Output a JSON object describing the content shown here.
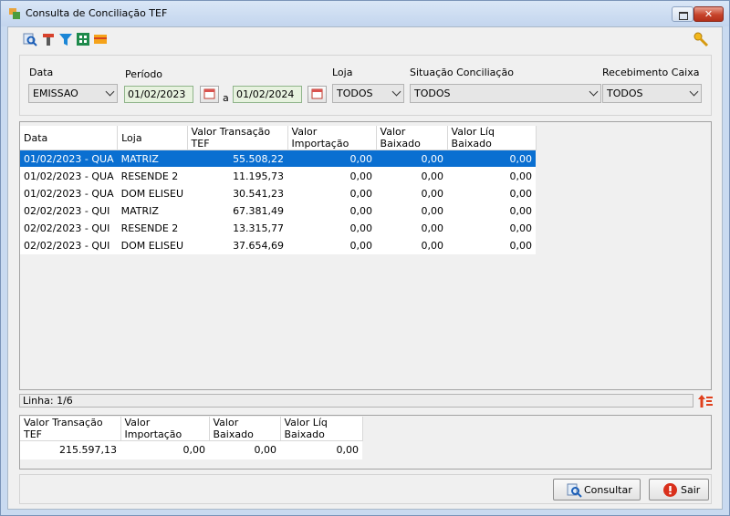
{
  "window": {
    "title": "Consulta de Conciliação TEF"
  },
  "filters": {
    "data_label": "Data",
    "data_value": "EMISSAO",
    "periodo_label": "Período",
    "date_from": "01/02/2023",
    "date_sep": "a",
    "date_to": "01/02/2024",
    "loja_label": "Loja",
    "loja_value": "TODOS",
    "situacao_label": "Situação Conciliação",
    "situacao_value": "TODOS",
    "receb_label": "Recebimento Caixa",
    "receb_value": "TODOS"
  },
  "grid": {
    "columns": [
      "Data",
      "Loja",
      "Valor Transação TEF",
      "Valor Importação",
      "Valor Baixado",
      "Valor Líq Baixado"
    ],
    "rows": [
      [
        "01/02/2023 - QUA",
        "MATRIZ",
        "55.508,22",
        "0,00",
        "0,00",
        "0,00"
      ],
      [
        "01/02/2023 - QUA",
        "RESENDE 2",
        "11.195,73",
        "0,00",
        "0,00",
        "0,00"
      ],
      [
        "01/02/2023 - QUA",
        "DOM ELISEU",
        "30.541,23",
        "0,00",
        "0,00",
        "0,00"
      ],
      [
        "02/02/2023 - QUI",
        "MATRIZ",
        "67.381,49",
        "0,00",
        "0,00",
        "0,00"
      ],
      [
        "02/02/2023 - QUI",
        "RESENDE 2",
        "13.315,77",
        "0,00",
        "0,00",
        "0,00"
      ],
      [
        "02/02/2023 - QUI",
        "DOM ELISEU",
        "37.654,69",
        "0,00",
        "0,00",
        "0,00"
      ]
    ],
    "selected_row": 0
  },
  "status": {
    "line": "Linha: 1/6"
  },
  "totals": {
    "columns": [
      "Valor Transação TEF",
      "Valor Importação",
      "Valor Baixado",
      "Valor Líq Baixado"
    ],
    "values": [
      "215.597,13",
      "0,00",
      "0,00",
      "0,00"
    ]
  },
  "buttons": {
    "consultar": "Consultar",
    "sair": "Sair"
  },
  "colors": {
    "selection": "#0a6fd1",
    "close": "#c7432b"
  }
}
